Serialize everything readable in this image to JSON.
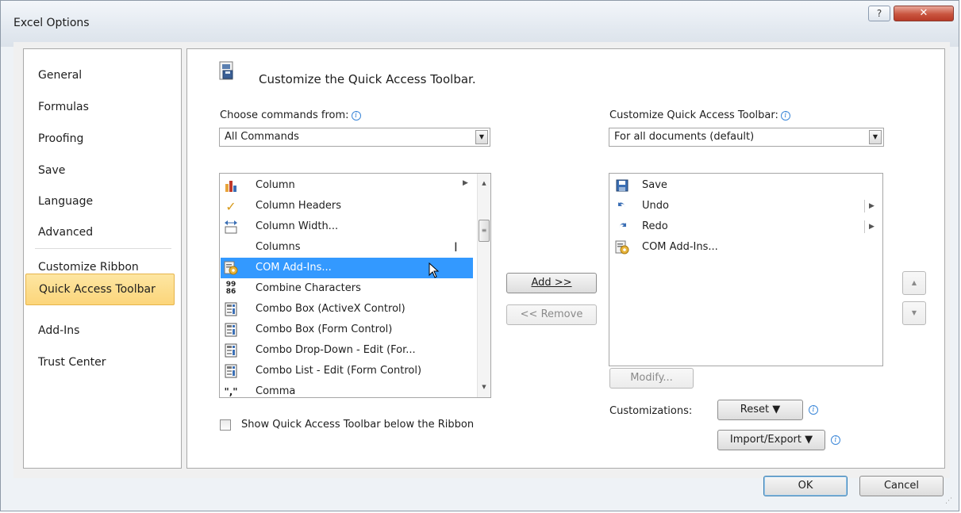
{
  "window": {
    "title": "Excel Options",
    "help_label": "?",
    "close_label": "✕"
  },
  "nav": {
    "items": [
      {
        "label": "General",
        "active": false
      },
      {
        "label": "Formulas",
        "active": false
      },
      {
        "label": "Proofing",
        "active": false
      },
      {
        "label": "Save",
        "active": false
      },
      {
        "label": "Language",
        "active": false
      },
      {
        "label": "Advanced",
        "active": false
      },
      {
        "label": "Customize Ribbon",
        "active": false
      },
      {
        "label": "Quick Access Toolbar",
        "active": true
      },
      {
        "label": "Add-Ins",
        "active": false
      },
      {
        "label": "Trust Center",
        "active": false
      }
    ]
  },
  "main": {
    "heading": "Customize the Quick Access Toolbar.",
    "choose_label": "Choose commands from:",
    "choose_value": "All Commands",
    "customize_label": "Customize Quick Access Toolbar:",
    "customize_value": "For all documents (default)",
    "commands": [
      {
        "label": "Column",
        "icon": "column-chart-icon",
        "submenu": "▶",
        "selected": false
      },
      {
        "label": "Column Headers",
        "icon": "checkmark-icon",
        "submenu": "",
        "selected": false
      },
      {
        "label": "Column Width...",
        "icon": "column-width-icon",
        "submenu": "",
        "selected": false
      },
      {
        "label": "Columns",
        "icon": "",
        "submenu": "",
        "selected": false
      },
      {
        "label": "COM Add-Ins...",
        "icon": "com-addins-icon",
        "submenu": "",
        "selected": true
      },
      {
        "label": "Combine Characters",
        "icon": "combine-characters-icon",
        "submenu": "",
        "selected": false
      },
      {
        "label": "Combo Box (ActiveX Control)",
        "icon": "combo-box-icon",
        "submenu": "",
        "selected": false
      },
      {
        "label": "Combo Box (Form Control)",
        "icon": "combo-box-icon",
        "submenu": "",
        "selected": false
      },
      {
        "label": "Combo Drop-Down - Edit (For...",
        "icon": "combo-box-icon",
        "submenu": "",
        "selected": false
      },
      {
        "label": "Combo List - Edit (Form Control)",
        "icon": "combo-box-icon",
        "submenu": "",
        "selected": false
      },
      {
        "label": "Comma",
        "icon": "comma-style-icon",
        "submenu": "",
        "selected": false
      }
    ],
    "toolbar_items": [
      {
        "label": "Save",
        "icon": "save-icon",
        "submenu": ""
      },
      {
        "label": "Undo",
        "icon": "undo-icon",
        "submenu": "▶"
      },
      {
        "label": "Redo",
        "icon": "redo-icon",
        "submenu": "▶"
      },
      {
        "label": "COM Add-Ins...",
        "icon": "com-addins-icon",
        "submenu": ""
      }
    ],
    "add_button": "Add >>",
    "remove_button": "<< Remove",
    "modify_button": "Modify...",
    "move_up_label": "▲",
    "move_down_label": "▼",
    "checkbox_label": "Show Quick Access Toolbar below the Ribbon",
    "checkbox_checked": false,
    "customizations_label": "Customizations:",
    "reset_button": "Reset ▼",
    "import_export_button": "Import/Export ▼"
  },
  "footer": {
    "ok_button": "OK",
    "cancel_button": "Cancel"
  },
  "colors": {
    "selection": "#3399ff",
    "active_nav": "#fcd57a",
    "close_button": "#c9553f"
  }
}
